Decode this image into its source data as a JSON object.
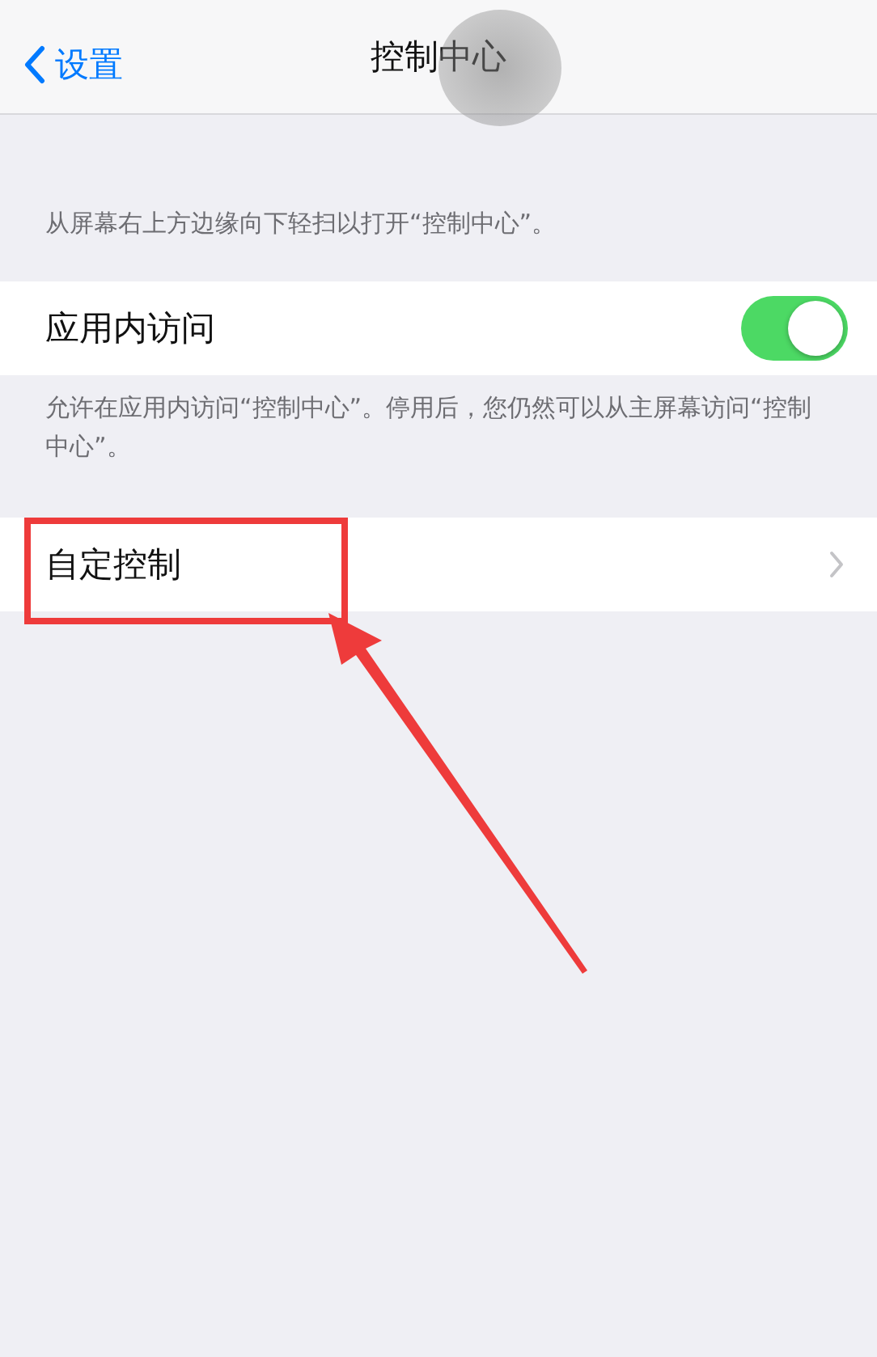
{
  "nav": {
    "back_label": "设置",
    "title": "控制中心"
  },
  "intro": "从屏幕右上方边缘向下轻扫以打开“控制中心”。",
  "access_row": {
    "label": "应用内访问",
    "on": true
  },
  "access_footer": "允许在应用内访问“控制中心”。停用后，您仍然可以从主屏幕访问“控制中心”。",
  "customize_row": {
    "label": "自定控制"
  }
}
